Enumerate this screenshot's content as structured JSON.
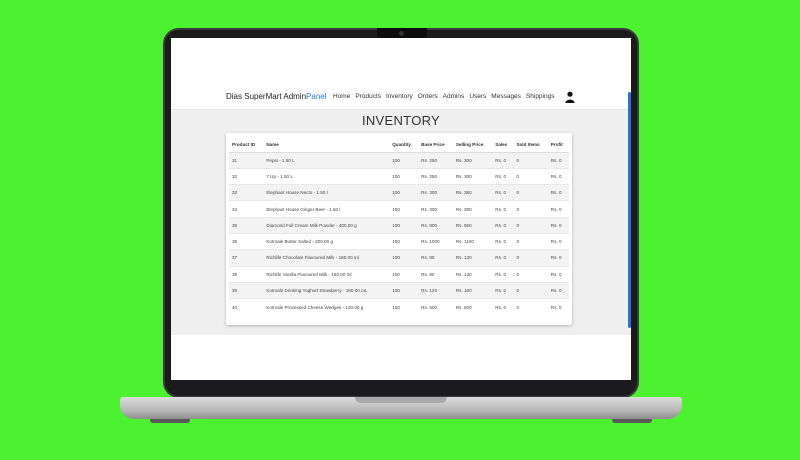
{
  "app": {
    "brand_main": "Dias SuperMart Admin",
    "brand_accent": "Panel"
  },
  "nav": {
    "items": [
      "Home",
      "Products",
      "Inventory",
      "Orders",
      "Admins",
      "Users",
      "Messages",
      "Shippings"
    ]
  },
  "page": {
    "title": "INVENTORY"
  },
  "table": {
    "headers": [
      "Product ID",
      "Name",
      "Quantity",
      "Base Price",
      "Selling Price",
      "Sales",
      "Sold Items",
      "Profit"
    ],
    "rows": [
      [
        "31",
        "Pepsi - 1.50 L",
        "100",
        "Rs. 250",
        "Rs. 300",
        "Rs. 0",
        "0",
        "Rs. 0"
      ],
      [
        "32",
        "7 Up - 1.50 L",
        "100",
        "Rs. 250",
        "Rs. 300",
        "Rs. 0",
        "0",
        "Rs. 0"
      ],
      [
        "33",
        "Elephant House Necto - 1.50 l",
        "100",
        "Rs. 300",
        "Rs. 380",
        "Rs. 0",
        "0",
        "Rs. 0"
      ],
      [
        "34",
        "Elephant House Ginger Beer - 1.50 l",
        "100",
        "Rs. 300",
        "Rs. 380",
        "Rs. 0",
        "0",
        "Rs. 0"
      ],
      [
        "35",
        "Diamond Full Cream Milk Powder - 400.00 g",
        "100",
        "Rs. 800",
        "Rs. 950",
        "Rs. 0",
        "0",
        "Rs. 0"
      ],
      [
        "36",
        "Kotmale Butter Salted - 200.00 g",
        "100",
        "Rs. 1000",
        "Rs. 1100",
        "Rs. 0",
        "0",
        "Rs. 0"
      ],
      [
        "37",
        "Richlife Chocolate Flavoured Milk - 180.00 ml",
        "100",
        "Rs. 80",
        "Rs. 130",
        "Rs. 0",
        "0",
        "Rs. 0"
      ],
      [
        "38",
        "Richlife Vanilla Flavoured Milk - 180.00 ml",
        "100",
        "Rs. 80",
        "Rs. 130",
        "Rs. 0",
        "0",
        "Rs. 0"
      ],
      [
        "39",
        "Kotmale Drinking Yoghurt Strawberry - 180.00 mL",
        "100",
        "Rs. 120",
        "Rs. 160",
        "Rs. 0",
        "0",
        "Rs. 0"
      ],
      [
        "40",
        "Kotmale Processed Cheese Wedges - 120.00 g",
        "100",
        "Rs. 500",
        "Rs. 600",
        "Rs. 0",
        "0",
        "Rs. 0"
      ]
    ]
  },
  "icons": {
    "user": "user-icon"
  },
  "colors": {
    "background": "#4cf22f",
    "accent": "#1e78d6",
    "scrollbar": "#2f6fd1"
  }
}
